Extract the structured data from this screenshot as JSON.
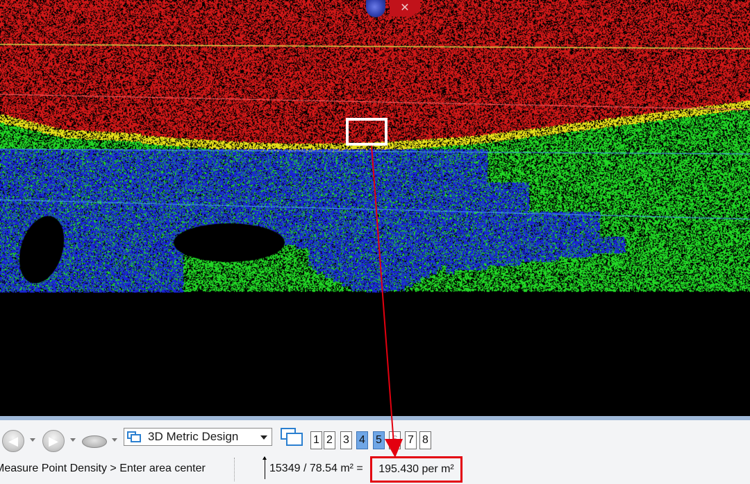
{
  "viewport": {
    "band_colors": {
      "top_surface": "#d01818",
      "edge_band": "#e6e019",
      "mid_surface": "#22d826",
      "low_surface": "#1a26d6",
      "background": "#000000"
    },
    "orb_icon": "globe-view-icon",
    "close_icon": "x-close-icon"
  },
  "toolbar": {
    "back_icon": "arrow-left-icon",
    "forward_icon": "arrow-right-icon",
    "disk_icon": "disk-icon",
    "dropdown_icon": "chevron-down-icon",
    "design_select_value": "3D Metric Design",
    "views_icon": "windows-icon",
    "view_numbers": [
      "1",
      "2",
      "3",
      "4",
      "5",
      "6",
      "7",
      "8"
    ],
    "active_views": [
      "4",
      "5"
    ]
  },
  "status": {
    "prompt": "Measure Point Density > Enter area center",
    "formula": "15349 / 78.54 m² =",
    "result": "195.430 per m²"
  },
  "annotation": {
    "color": "#e3000f"
  }
}
